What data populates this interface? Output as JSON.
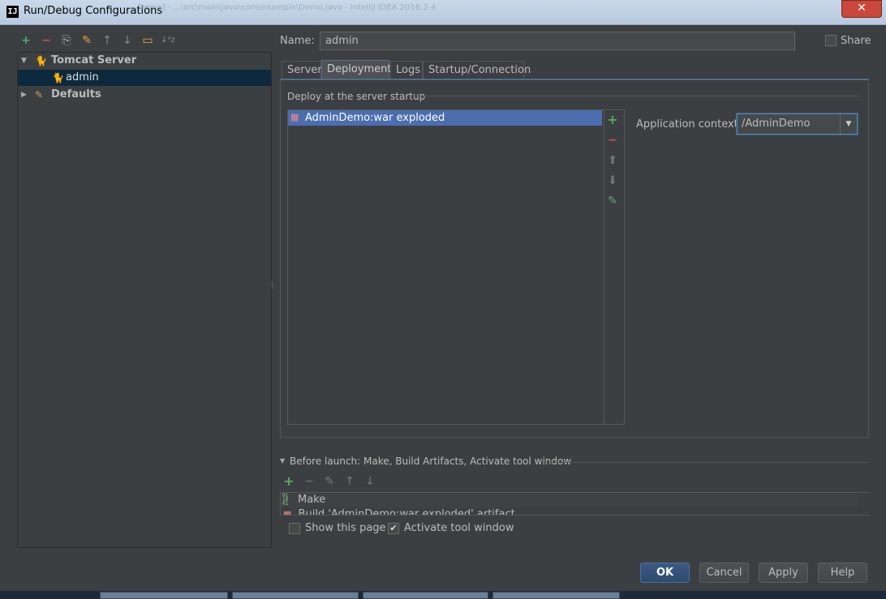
{
  "window": {
    "title": "Run/Debug Configurations",
    "app_icon": "IJ",
    "background_title": "Demo] - ...\\src\\main\\java\\com\\example\\Demo.java - IntelliJ IDEA 2016.2.4",
    "close_glyph": "✕"
  },
  "toolbar": {
    "add": "+",
    "remove": "−",
    "copy": "⎘",
    "edit_defaults": "✎",
    "move_up": "↑",
    "move_down": "↓",
    "folder": "▭",
    "sort": "↓ᵃz"
  },
  "tree": {
    "items": [
      {
        "label": "Tomcat Server",
        "expanded": true,
        "arrow": "▼",
        "icon": "tomcat-icon"
      },
      {
        "label": "admin",
        "selected": true,
        "icon": "tomcat-icon"
      },
      {
        "label": "Defaults",
        "expanded": false,
        "arrow": "▶",
        "icon": "wrench-icon"
      }
    ]
  },
  "name_field": {
    "label": "Name:",
    "value": "admin"
  },
  "share": {
    "label": "Share",
    "checked": false
  },
  "tabs": [
    {
      "label": "Server",
      "active": false
    },
    {
      "label": "Deployment",
      "active": true
    },
    {
      "label": "Logs",
      "active": false
    },
    {
      "label": "Startup/Connection",
      "active": false
    }
  ],
  "deployment": {
    "section_title": "Deploy at the server startup",
    "artifacts": [
      {
        "label": "AdminDemo:war exploded",
        "selected": true
      }
    ],
    "side_tools": {
      "add": "+",
      "remove": "−",
      "up": "⬆",
      "down": "⬇",
      "edit": "✎"
    },
    "app_context": {
      "label": "Application context:",
      "value": "/AdminDemo",
      "dropdown": "▼"
    }
  },
  "before_launch": {
    "arrow": "▼",
    "title": "Before launch: Make, Build Artifacts, Activate tool window",
    "tools": {
      "add": "+",
      "remove": "−",
      "edit": "✎",
      "up": "↑",
      "down": "↓"
    },
    "tasks": [
      {
        "label": "Make",
        "icon": "make-icon"
      },
      {
        "label": "Build 'AdminDemo:war exploded' artifact",
        "icon": "artifact-icon"
      }
    ]
  },
  "options": {
    "show_page": {
      "label": "Show this page",
      "checked": false
    },
    "activate_tool": {
      "label": "Activate tool window",
      "checked": true,
      "mark": "✔"
    }
  },
  "buttons": {
    "ok": "OK",
    "cancel": "Cancel",
    "apply": "Apply",
    "help": "Help"
  },
  "colors": {
    "panel_bg": "#3c3f41",
    "selection": "#4b6eaf",
    "tree_selection": "#0d293e",
    "add_green": "#59a869",
    "remove_red": "#c75450",
    "accent_blue": "#4a88c7"
  }
}
